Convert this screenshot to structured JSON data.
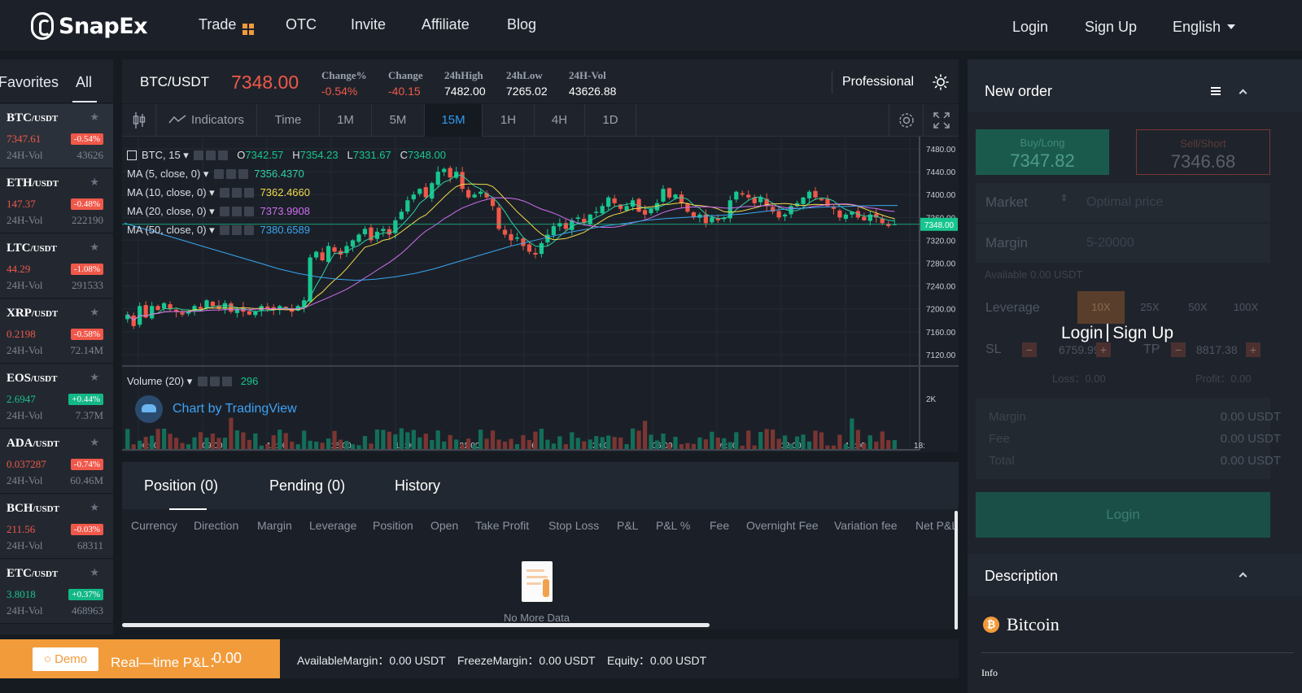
{
  "nav": {
    "logo": "SnapEx",
    "items": [
      "Trade",
      "OTC",
      "Invite",
      "Affiliate",
      "Blog"
    ],
    "login": "Login",
    "signup": "Sign Up",
    "language": "English"
  },
  "markets": {
    "tabs": [
      "Favorites",
      "All"
    ],
    "quote": "/USDT",
    "vol_label": "24H-Vol",
    "coins": [
      {
        "symbol": "BTC",
        "price": "7347.61",
        "change": "-0.54%",
        "vol": "43626",
        "dir": "down"
      },
      {
        "symbol": "ETH",
        "price": "147.37",
        "change": "-0.48%",
        "vol": "222190",
        "dir": "down"
      },
      {
        "symbol": "LTC",
        "price": "44.29",
        "change": "-1.08%",
        "vol": "291533",
        "dir": "down"
      },
      {
        "symbol": "XRP",
        "price": "0.2198",
        "change": "-0.58%",
        "vol": "72.14M",
        "dir": "down"
      },
      {
        "symbol": "EOS",
        "price": "2.6947",
        "change": "+0.44%",
        "vol": "7.37M",
        "dir": "up"
      },
      {
        "symbol": "ADA",
        "price": "0.037287",
        "change": "-0.74%",
        "vol": "60.46M",
        "dir": "down"
      },
      {
        "symbol": "BCH",
        "price": "211.56",
        "change": "-0.03%",
        "vol": "68311",
        "dir": "down"
      },
      {
        "symbol": "ETC",
        "price": "3.8018",
        "change": "+0.37%",
        "vol": "468963",
        "dir": "up"
      }
    ]
  },
  "ticker": {
    "pair": "BTC/USDT",
    "price": "7348.00",
    "stats": [
      {
        "label": "Change%",
        "value": "-0.54%",
        "color": "red"
      },
      {
        "label": "Change",
        "value": "-40.15",
        "color": "red"
      },
      {
        "label": "24hHigh",
        "value": "7482.00",
        "color": "white"
      },
      {
        "label": "24hLow",
        "value": "7265.02",
        "color": "white"
      },
      {
        "label": "24H-Vol",
        "value": "43626.88",
        "color": "white"
      }
    ],
    "mode": "Professional"
  },
  "toolbar": {
    "indicators": "Indicators",
    "time": "Time",
    "intervals": [
      "1M",
      "5M",
      "15M",
      "1H",
      "4H",
      "1D"
    ],
    "active_interval": "15M"
  },
  "chart_legend": {
    "symbol": "BTC, 15",
    "o_label": "O",
    "o": "7342.57",
    "h_label": "H",
    "h": "7354.23",
    "l_label": "L",
    "l": "7331.67",
    "c_label": "C",
    "c": "7348.00",
    "mas": [
      {
        "label": "MA (5, close, 0)",
        "value": "7356.4370",
        "color": "#2fd0a0"
      },
      {
        "label": "MA (10, close, 0)",
        "value": "7362.4660",
        "color": "#f2d94b"
      },
      {
        "label": "MA (20, close, 0)",
        "value": "7373.9908",
        "color": "#d06ef0"
      },
      {
        "label": "MA (50, close, 0)",
        "value": "7380.6589",
        "color": "#3aa6f0"
      }
    ],
    "volume_label": "Volume (20)",
    "volume_value": "296",
    "watermark": "Chart by TradingView"
  },
  "chart_data": {
    "type": "candlestick",
    "title": "",
    "ylim": [
      7100,
      7490
    ],
    "y_ticks": [
      "7480.00",
      "7440.00",
      "7400.00",
      "7360.00",
      "7320.00",
      "7280.00",
      "7240.00",
      "7200.00",
      "7160.00",
      "7120.00"
    ],
    "last_price_label": "7348.00",
    "volume_tick": "2K",
    "x_ticks": [
      "06:00",
      "09:00",
      "12:00",
      "15:00",
      "18:00",
      "21:00",
      "6",
      "03:00",
      "06:00",
      "09:00",
      "12:00",
      "15:00",
      "18:"
    ],
    "close_path": [
      7190,
      7170,
      7205,
      7185,
      7205,
      7198,
      7210,
      7200,
      7195,
      7190,
      7195,
      7205,
      7200,
      7215,
      7205,
      7200,
      7210,
      7195,
      7200,
      7195,
      7190,
      7195,
      7205,
      7200,
      7198,
      7205,
      7200,
      7195,
      7205,
      7215,
      7290,
      7300,
      7285,
      7310,
      7300,
      7295,
      7310,
      7320,
      7330,
      7340,
      7320,
      7335,
      7340,
      7330,
      7355,
      7370,
      7390,
      7400,
      7410,
      7395,
      7420,
      7440,
      7445,
      7430,
      7440,
      7410,
      7395,
      7400,
      7405,
      7395,
      7380,
      7340,
      7330,
      7320,
      7325,
      7310,
      7300,
      7295,
      7315,
      7330,
      7345,
      7350,
      7340,
      7355,
      7360,
      7350,
      7365,
      7370,
      7380,
      7395,
      7385,
      7375,
      7380,
      7390,
      7370,
      7365,
      7375,
      7385,
      7410,
      7395,
      7400,
      7385,
      7370,
      7360,
      7365,
      7350,
      7360,
      7355,
      7360,
      7390,
      7405,
      7400,
      7395,
      7385,
      7395,
      7380,
      7370,
      7360,
      7365,
      7380,
      7385,
      7395,
      7405,
      7395,
      7390,
      7380,
      7375,
      7360,
      7365,
      7370,
      7360,
      7355,
      7365,
      7360,
      7350,
      7345,
      7348
    ],
    "ma50_path": [
      7350,
      7340,
      7330,
      7320,
      7310,
      7300,
      7290,
      7280,
      7270,
      7262,
      7256,
      7252,
      7250,
      7252,
      7256,
      7262,
      7270,
      7280,
      7290,
      7300,
      7310,
      7318,
      7326,
      7334,
      7340,
      7346,
      7350,
      7355,
      7358,
      7360,
      7362,
      7364,
      7366,
      7370,
      7374,
      7376,
      7378,
      7379,
      7380,
      7381,
      7381
    ]
  },
  "positions": {
    "tabs": [
      "Position (0)",
      "Pending (0)",
      "History"
    ],
    "columns": [
      "Currency",
      "Direction",
      "Margin",
      "Leverage",
      "Position",
      "Open",
      "Take Profit",
      "Stop Loss",
      "P&L",
      "P&L %",
      "Fee",
      "Overnight Fee",
      "Variation fee",
      "Net P&L"
    ],
    "empty": "No More Data"
  },
  "bottom": {
    "demo": "Demo",
    "realtime_label": "Real—time P&L：",
    "realtime_value": "0.00",
    "available": "AvailableMargin：0.00 USDT",
    "freeze": "FreezeMargin：0.00 USDT",
    "equity": "Equity：0.00 USDT"
  },
  "order": {
    "title": "New order",
    "buy_label": "Buy/Long",
    "buy_price": "7347.82",
    "sell_label": "Sell/Short",
    "sell_price": "7346.68",
    "market_label": "Market",
    "market_placeholder": "Optimal price",
    "margin_label": "Margin",
    "margin_placeholder": "5-20000",
    "available": "Available 0.00 USDT",
    "leverage_label": "Leverage",
    "leverages": [
      "10X",
      "25X",
      "50X",
      "100X"
    ],
    "sl_label": "SL",
    "sl_value": "6759.99",
    "tp_label": "TP",
    "tp_value": "8817.38",
    "loss_label": "Loss：0.00",
    "profit_label": "Profit：0.00",
    "summary": [
      {
        "label": "Margin",
        "value": "0.00 USDT"
      },
      {
        "label": "Fee",
        "value": "0.00 USDT"
      },
      {
        "label": "Total",
        "value": "0.00 USDT"
      }
    ],
    "login_button": "Login",
    "overlay_login": "Login",
    "overlay_signup": "Sign Up"
  },
  "description": {
    "title": "Description",
    "coin": "Bitcoin",
    "info": "Info"
  },
  "colors": {
    "up": "#17c68f",
    "down": "#f0584a",
    "accent": "#2e9bf0",
    "demo": "#f29b3a"
  }
}
